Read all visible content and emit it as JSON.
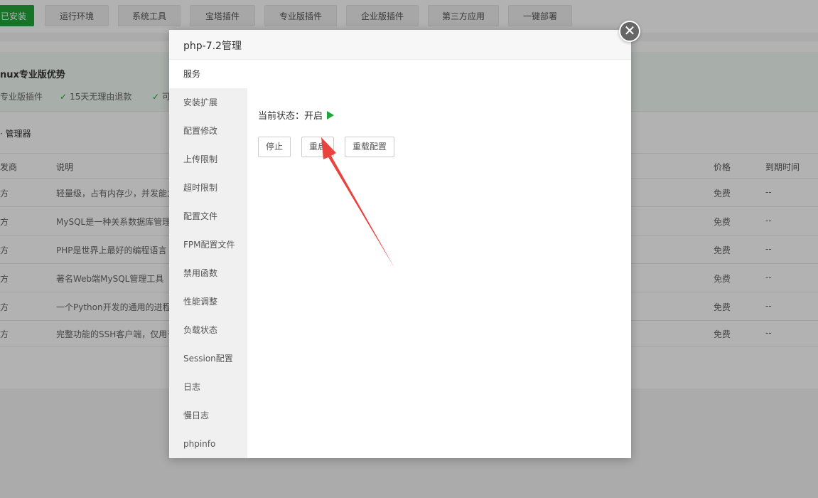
{
  "nav": {
    "items": [
      "已安装",
      "运行环境",
      "系统工具",
      "宝塔插件",
      "专业版插件",
      "企业版插件",
      "第三方应用",
      "一键部署"
    ]
  },
  "promo": {
    "title": "nux专业版优势",
    "items": [
      "专业版插件",
      "15天无理由退款",
      "可"
    ]
  },
  "section_title": "管理器",
  "table": {
    "headers": [
      "发商",
      "说明",
      "价格",
      "到期时间"
    ],
    "rows": [
      {
        "dev": "方",
        "desc": "轻量级，占有内存少，并发能力",
        "price": "免费",
        "expire": "--"
      },
      {
        "dev": "方",
        "desc": "MySQL是一种关系数据库管理",
        "price": "免费",
        "expire": "--"
      },
      {
        "dev": "方",
        "desc": "PHP是世界上最好的编程语言",
        "price": "免费",
        "expire": "--"
      },
      {
        "dev": "方",
        "desc": "著名Web端MySQL管理工具",
        "price": "免费",
        "expire": "--"
      },
      {
        "dev": "方",
        "desc": "一个Python开发的通用的进程",
        "price": "免费",
        "expire": "--"
      },
      {
        "dev": "方",
        "desc": "完整功能的SSH客户端，仅用于",
        "price": "免费",
        "expire": "--"
      }
    ]
  },
  "modal": {
    "title": "php-7.2管理",
    "close_symbol": "✕",
    "menu": [
      "服务",
      "安装扩展",
      "配置修改",
      "上传限制",
      "超时限制",
      "配置文件",
      "FPM配置文件",
      "禁用函数",
      "性能调整",
      "负载状态",
      "Session配置",
      "日志",
      "慢日志",
      "phpinfo"
    ],
    "status_label": "当前状态：开启",
    "buttons": {
      "stop": "停止",
      "restart": "重启",
      "reload": "重载配置"
    }
  },
  "colors": {
    "accent": "#20a53a",
    "arrow": "#e8433f"
  }
}
